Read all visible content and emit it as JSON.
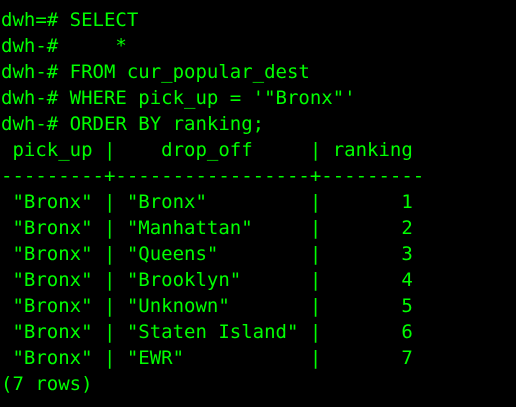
{
  "colors": {
    "background": "#000000",
    "foreground": "#00ff00"
  },
  "terminal": {
    "lines": [
      "dwh=# SELECT",
      "dwh-#     *",
      "dwh-# FROM cur_popular_dest",
      "dwh-# WHERE pick_up = '\"Bronx\"'",
      "dwh-# ORDER BY ranking;",
      " pick_up |    drop_off     | ranking",
      "---------+-----------------+---------",
      " \"Bronx\" | \"Bronx\"         |       1",
      " \"Bronx\" | \"Manhattan\"     |       2",
      " \"Bronx\" | \"Queens\"        |       3",
      " \"Bronx\" | \"Brooklyn\"      |       4",
      " \"Bronx\" | \"Unknown\"       |       5",
      " \"Bronx\" | \"Staten Island\" |       6",
      " \"Bronx\" | \"EWR\"           |       7",
      "(7 rows)"
    ]
  }
}
